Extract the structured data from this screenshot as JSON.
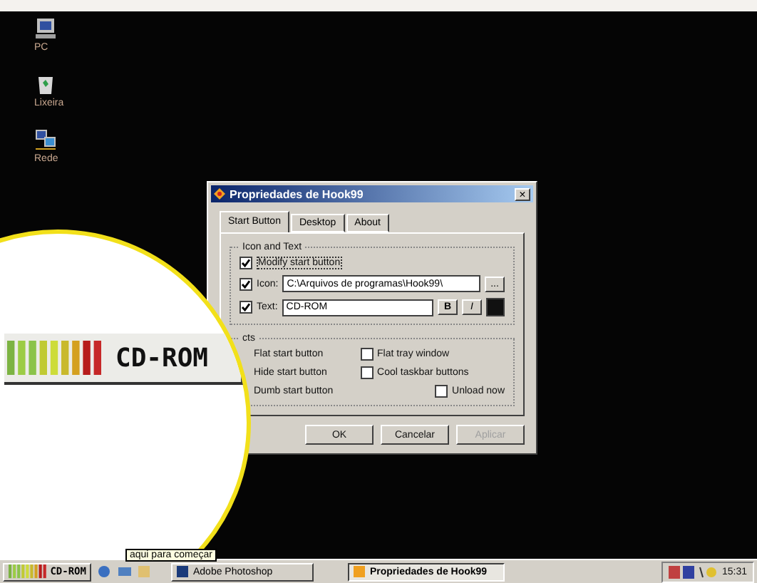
{
  "desktop_icons": [
    {
      "label": "PC",
      "kind": "computer"
    },
    {
      "label": "Lixeira",
      "kind": "bin"
    },
    {
      "label": "Rede",
      "kind": "network"
    }
  ],
  "dialog": {
    "title": "Propriedades de Hook99",
    "close": "×",
    "tabs": [
      {
        "label": "Start Button",
        "selected": true
      },
      {
        "label": "Desktop",
        "selected": false
      },
      {
        "label": "About",
        "selected": false
      }
    ],
    "icon_text_group": {
      "label": "Icon and Text",
      "modify": {
        "label": "Modify start button",
        "checked": true
      },
      "icon": {
        "label": "Icon:",
        "checked": true,
        "value": "C:\\Arquivos de programas\\Hook99\\",
        "browse": "..."
      },
      "text": {
        "label": "Text:",
        "checked": true,
        "value": "CD-ROM",
        "bold": "B",
        "italic": "I",
        "color": "#111111"
      }
    },
    "effects_group": {
      "label": "cts",
      "items": [
        {
          "label": "Flat start button",
          "kind": "label"
        },
        {
          "label": "Flat tray window",
          "kind": "checkbox",
          "checked": false
        },
        {
          "label": "Hide start button",
          "kind": "label"
        },
        {
          "label": "Cool taskbar buttons",
          "kind": "checkbox",
          "checked": false
        },
        {
          "label": "Dumb start button",
          "kind": "label"
        },
        {
          "label": "Unload now",
          "kind": "checkbox",
          "checked": false
        }
      ]
    },
    "buttons": [
      {
        "label": "OK",
        "disabled": false
      },
      {
        "label": "Cancelar",
        "disabled": false
      },
      {
        "label": "Aplicar",
        "disabled": true
      }
    ]
  },
  "magnifier": {
    "start_label": "CD-ROM"
  },
  "taskbar": {
    "start_label": "CD-ROM",
    "tooltip": "aqui para começar",
    "tasks": [
      {
        "label": "Adobe Photoshop",
        "selected": false
      },
      {
        "label": "Propriedades de Hook99",
        "selected": true
      }
    ],
    "clock": "15:31"
  }
}
